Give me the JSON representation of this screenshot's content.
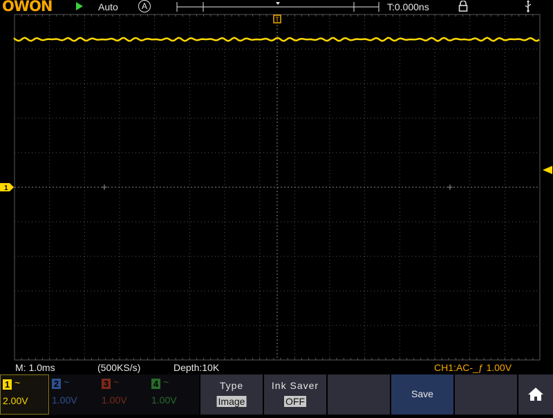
{
  "topbar": {
    "logo": "OWON",
    "trigger_mode": "Auto",
    "acq_icon": "A",
    "trigger_time": "T:0.000ns",
    "icons": [
      "run-icon",
      "lock-icon",
      "usb-icon"
    ]
  },
  "markers": {
    "trigger_pos": "T",
    "ch1": "1"
  },
  "status": {
    "timebase": "M: 1.0ms",
    "sample_rate": "(500KS/s)",
    "depth": "Depth:10K",
    "trigger_info": "CH1:AC-_ƒ 1.00V"
  },
  "channels": [
    {
      "num": "1",
      "coupling": "~",
      "scale": "2.00V",
      "color": "#ffd800",
      "active": true
    },
    {
      "num": "2",
      "coupling": "~",
      "scale": "1.00V",
      "color": "#2f4f8f",
      "active": false
    },
    {
      "num": "3",
      "coupling": "~",
      "scale": "1.00V",
      "color": "#7a2a1a",
      "active": false
    },
    {
      "num": "4",
      "coupling": "~",
      "scale": "1.00V",
      "color": "#2a6a2a",
      "active": false
    }
  ],
  "menu": {
    "type_title": "Type",
    "type_value": "Image",
    "ink_title": "Ink Saver",
    "ink_value": "OFF",
    "save": "Save",
    "home_icon": "home-icon"
  },
  "colors": {
    "ch1": "#ffd800",
    "grid": "#5a5a5a",
    "logo": "#f5a800",
    "run": "#3ad13a",
    "save_bg": "#26375e"
  }
}
